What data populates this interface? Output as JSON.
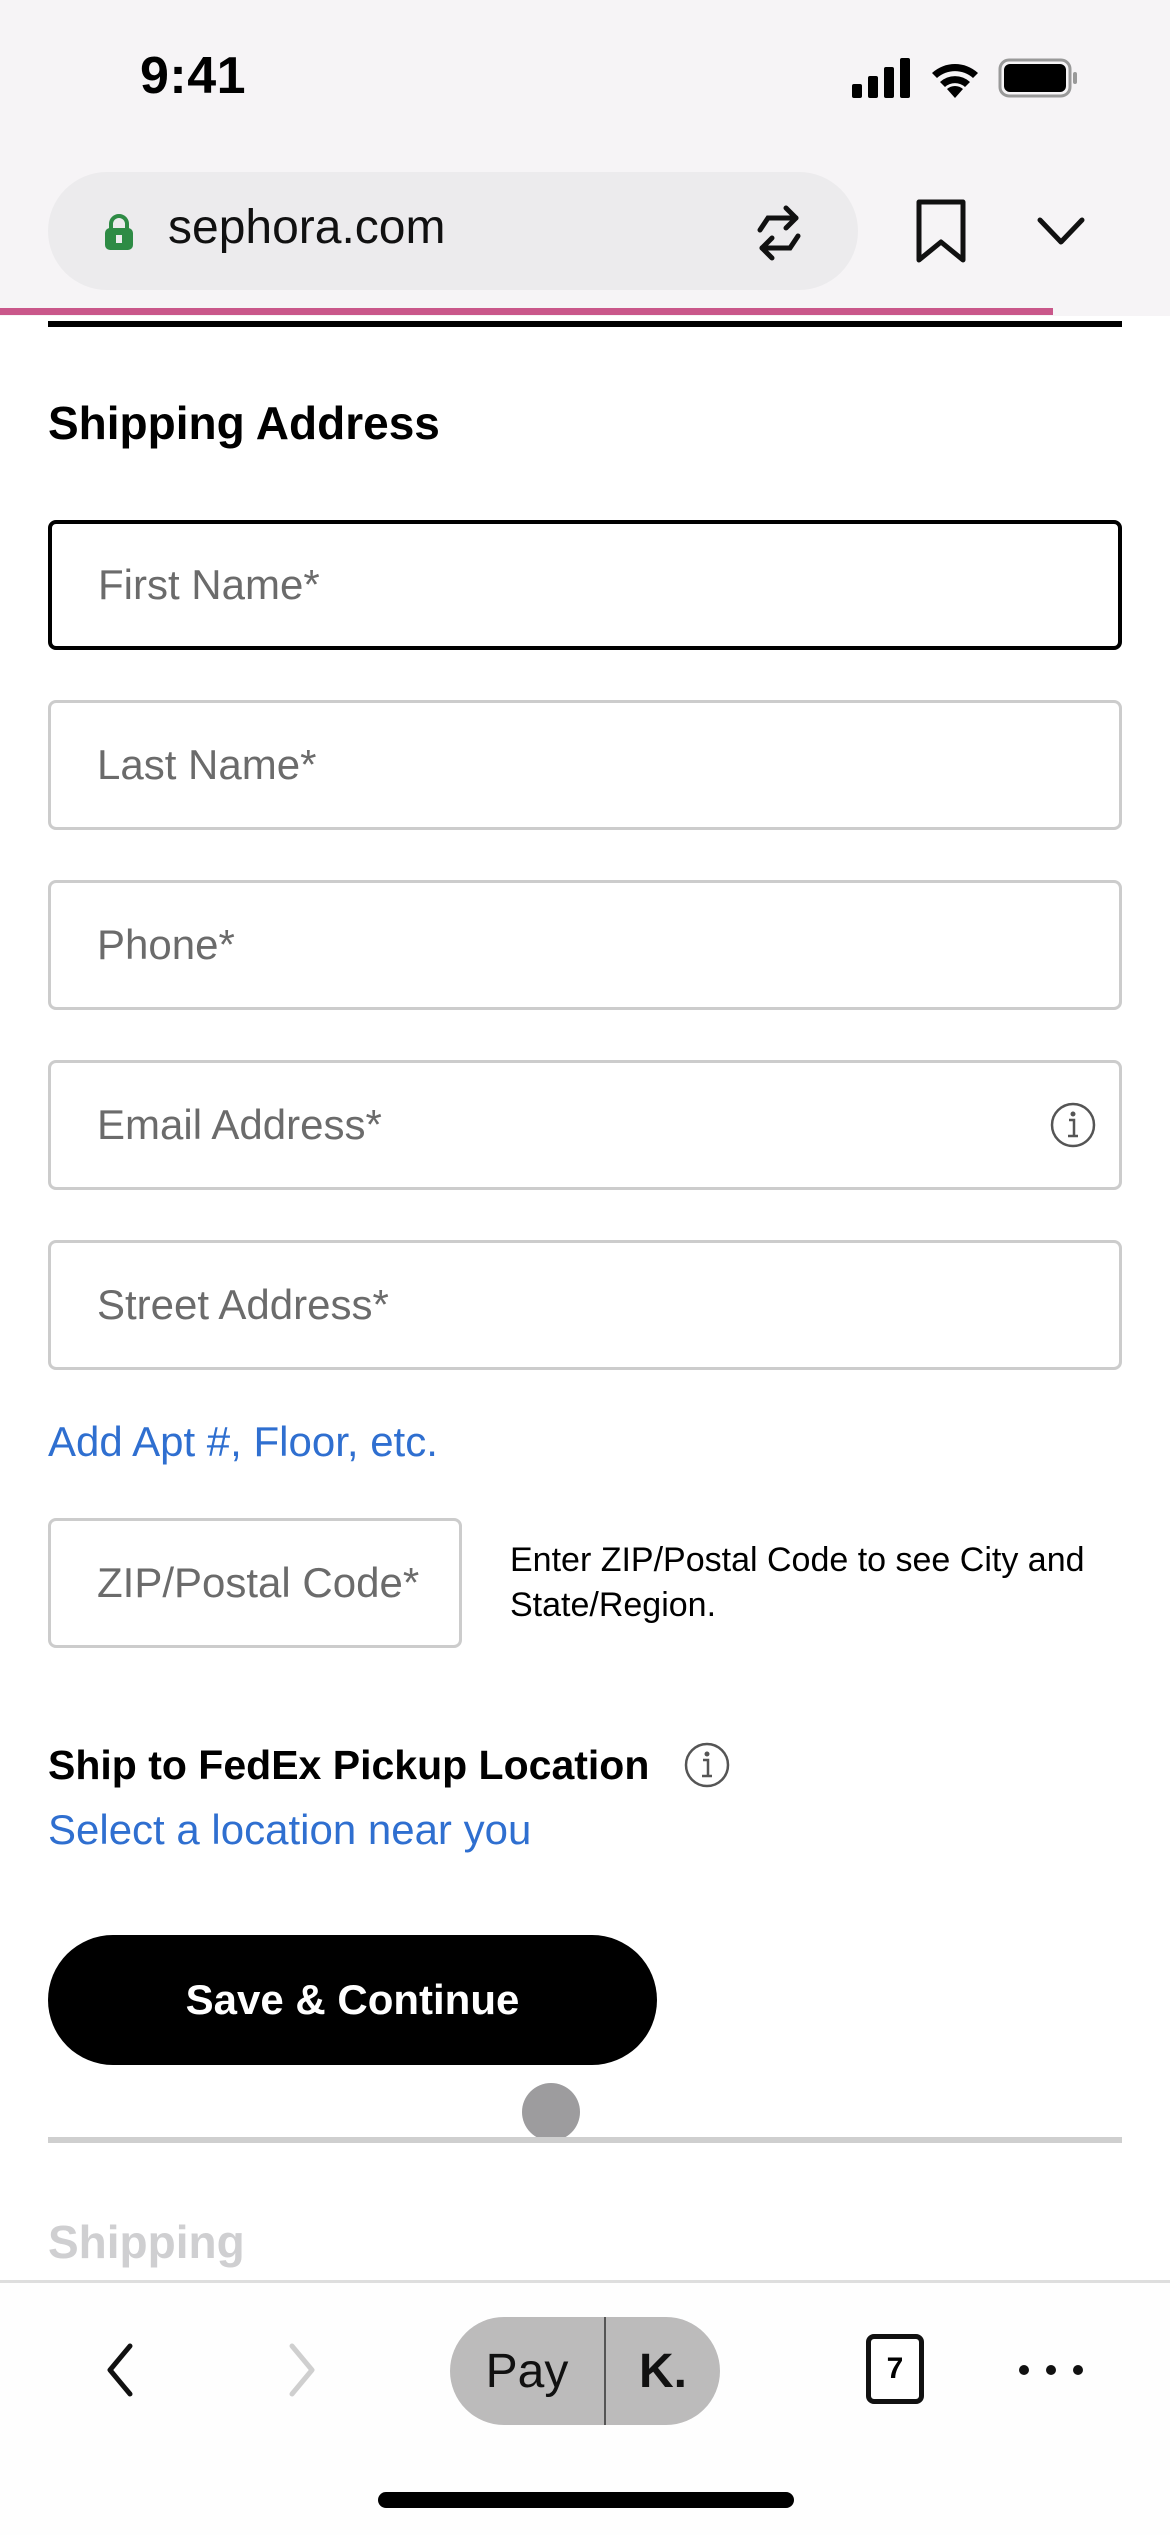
{
  "status_bar": {
    "time": "9:41"
  },
  "browser": {
    "url": "sephora.com",
    "load_progress_percent": 90,
    "icons": {
      "lock": "lock-icon",
      "reload": "reload-icon",
      "bookmark": "bookmark-icon",
      "menu": "chevron-down-icon"
    }
  },
  "form": {
    "title": "Shipping Address",
    "fields": [
      {
        "placeholder": "First Name*",
        "value": ""
      },
      {
        "placeholder": "Last Name*",
        "value": ""
      },
      {
        "placeholder": "Phone*",
        "value": ""
      },
      {
        "placeholder": "Email Address*",
        "value": ""
      },
      {
        "placeholder": "Street Address*",
        "value": ""
      }
    ],
    "add_apt_link": "Add Apt #, Floor, etc.",
    "zip": {
      "placeholder": "ZIP/Postal Code*",
      "value": ""
    },
    "zip_helper": "Enter ZIP/Postal Code to see City and State/Region.",
    "fedex_title": "Ship to FedEx Pickup Location",
    "fedex_link": "Select a location near you",
    "save_button": "Save & Continue",
    "next_section": "Shipping"
  },
  "toolbar": {
    "pay_label": "Pay",
    "klarna_label": "K.",
    "tab_count": "7"
  },
  "colors": {
    "accent_progress": "#c9578a",
    "link": "#2f6fd0",
    "primary_button": "#000000",
    "lock_green": "#2e8b45"
  }
}
